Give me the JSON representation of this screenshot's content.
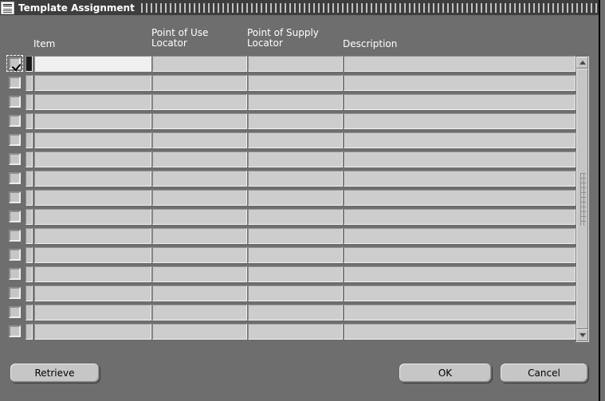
{
  "window": {
    "title": "Template Assignment",
    "icon": "form-document-icon",
    "background_color": "#6e6e6e",
    "titlebar_color": "#3d3d3d"
  },
  "grid": {
    "columns": [
      {
        "key": "item",
        "label": "Item"
      },
      {
        "key": "point_of_use",
        "label": "Point of Use\nLocator"
      },
      {
        "key": "point_of_supply",
        "label": "Point of Supply\nLocator"
      },
      {
        "key": "description",
        "label": "Description"
      }
    ],
    "row_count": 15,
    "rows": [
      {
        "selected": true,
        "current": true,
        "item": "",
        "point_of_use": "",
        "point_of_supply": "",
        "description": ""
      },
      {
        "selected": false,
        "current": false,
        "item": "",
        "point_of_use": "",
        "point_of_supply": "",
        "description": ""
      },
      {
        "selected": false,
        "current": false,
        "item": "",
        "point_of_use": "",
        "point_of_supply": "",
        "description": ""
      },
      {
        "selected": false,
        "current": false,
        "item": "",
        "point_of_use": "",
        "point_of_supply": "",
        "description": ""
      },
      {
        "selected": false,
        "current": false,
        "item": "",
        "point_of_use": "",
        "point_of_supply": "",
        "description": ""
      },
      {
        "selected": false,
        "current": false,
        "item": "",
        "point_of_use": "",
        "point_of_supply": "",
        "description": ""
      },
      {
        "selected": false,
        "current": false,
        "item": "",
        "point_of_use": "",
        "point_of_supply": "",
        "description": ""
      },
      {
        "selected": false,
        "current": false,
        "item": "",
        "point_of_use": "",
        "point_of_supply": "",
        "description": ""
      },
      {
        "selected": false,
        "current": false,
        "item": "",
        "point_of_use": "",
        "point_of_supply": "",
        "description": ""
      },
      {
        "selected": false,
        "current": false,
        "item": "",
        "point_of_use": "",
        "point_of_supply": "",
        "description": ""
      },
      {
        "selected": false,
        "current": false,
        "item": "",
        "point_of_use": "",
        "point_of_supply": "",
        "description": ""
      },
      {
        "selected": false,
        "current": false,
        "item": "",
        "point_of_use": "",
        "point_of_supply": "",
        "description": ""
      },
      {
        "selected": false,
        "current": false,
        "item": "",
        "point_of_use": "",
        "point_of_supply": "",
        "description": ""
      },
      {
        "selected": false,
        "current": false,
        "item": "",
        "point_of_use": "",
        "point_of_supply": "",
        "description": ""
      },
      {
        "selected": false,
        "current": false,
        "item": "",
        "point_of_use": "",
        "point_of_supply": "",
        "description": ""
      }
    ]
  },
  "scrollbar": {
    "orientation": "vertical",
    "up_arrow": "triangle-up-icon",
    "down_arrow": "triangle-down-icon",
    "thumb_grip": "dotted-grip"
  },
  "buttons": {
    "retrieve": "Retrieve",
    "ok": "OK",
    "cancel": "Cancel"
  }
}
